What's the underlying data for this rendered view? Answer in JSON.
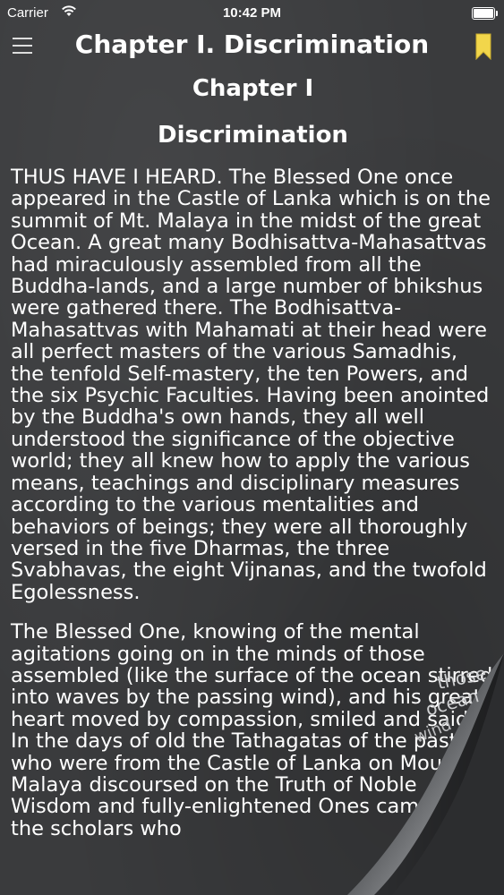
{
  "status_bar": {
    "carrier": "Carrier",
    "time": "10:42 PM",
    "wifi_icon": "wifi-icon",
    "battery_icon": "battery-icon"
  },
  "nav": {
    "title": "Chapter I. Discrimination",
    "menu_icon": "hamburger-menu-icon",
    "bookmark_icon": "bookmark-icon",
    "bookmark_color": "#f2d64b"
  },
  "content": {
    "chapter_heading": "Chapter I",
    "section_heading": "Discrimination",
    "paragraphs": [
      "THUS HAVE I HEARD. The Blessed One once appeared in the Castle of Lanka which is on the summit of Mt. Malaya in the midst of the great Ocean. A great many Bodhisattva-Mahasattvas had miraculously assembled from all the Buddha-lands, and a large number of bhikshus were gathered there. The Bodhisattva-Mahasattvas with Mahamati at their head were all perfect masters of the various Samadhis, the tenfold Self-mastery, the ten Powers, and the six Psychic Faculties. Having been anointed by the Buddha's own hands, they all well understood the significance of the objective world; they all knew how to apply the various means, teachings and disciplinary measures according to the various mentalities and behaviors of beings; they were all thoroughly versed in the five Dharmas, the three Svabhavas, the eight Vijnanas, and the twofold Egolessness.",
      "The Blessed One, knowing of the mental agitations going on in the minds of those assembled (like the surface of the ocean stirred into waves by the passing wind), and his great heart moved by compassion, smiled and said: In the days of old the Tathagatas of the past who were from the Castle of Lanka on Mount Malaya discoursed on the Truth of Noble Wisdom and fully-enlightened Ones came to the scholars who"
    ]
  },
  "page_curl": {
    "back_fragments": [
      "those",
      "ocean",
      "wind",
      "compassion"
    ]
  }
}
